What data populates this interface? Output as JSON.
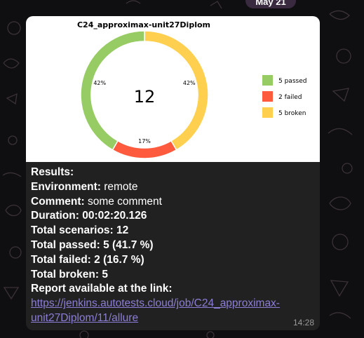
{
  "date_label": "May 21",
  "message": {
    "time": "14:28",
    "results": {
      "heading": "Results:",
      "environment_label": "Environment:",
      "environment_value": "remote",
      "comment_label": "Comment:",
      "comment_value": "some comment",
      "duration_label": "Duration:",
      "duration_value": "00:02:20.126",
      "total_scenarios_label": "Total scenarios:",
      "total_scenarios_value": "12",
      "total_passed_label": "Total passed:",
      "total_passed_value": "5 (41.7 %)",
      "total_failed_label": "Total failed:",
      "total_failed_value": "2 (16.7 %)",
      "total_broken_label": "Total broken:",
      "total_broken_value": "5",
      "report_label": "Report available at the link:",
      "report_link_line1": "https://jenkins.autotests.cloud/job/C24_approximax-",
      "report_link_line2": "unit27Diplom/11/allure"
    }
  },
  "chart_data": {
    "type": "pie",
    "title": "C24_approximax-unit27Diplom",
    "center_label": "12",
    "categories": [
      "passed",
      "failed",
      "broken"
    ],
    "values": [
      5,
      2,
      5
    ],
    "percent_labels": [
      "42%",
      "17%",
      "42%"
    ],
    "legend": [
      "5 passed",
      "2 failed",
      "5 broken"
    ],
    "colors": [
      "#97cc64",
      "#fd5a3e",
      "#ffd050"
    ],
    "legend_position": "right"
  }
}
